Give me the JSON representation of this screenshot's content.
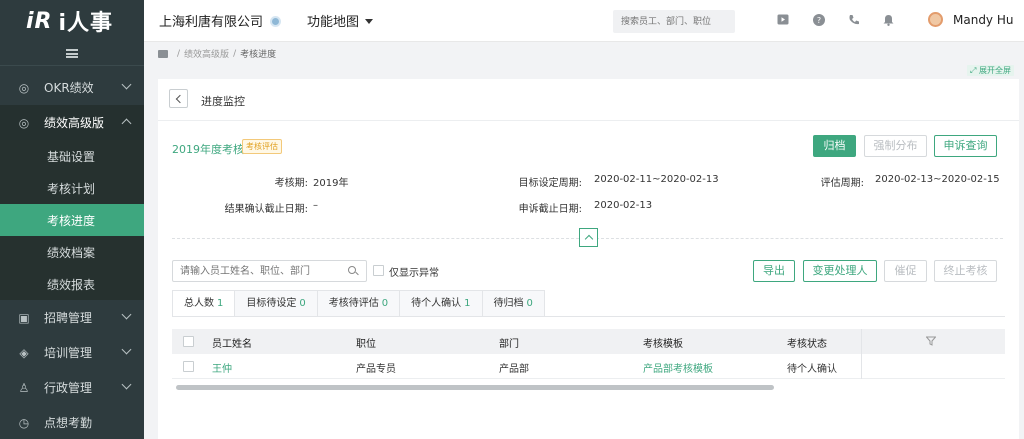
{
  "app": {
    "logo": "i人事",
    "logo_prefix": "iR"
  },
  "sidebar": {
    "items": [
      {
        "label": "OKR绩效",
        "icon": "target-icon"
      },
      {
        "label": "绩效高级版",
        "icon": "target-icon",
        "open": true
      },
      {
        "label": "招聘管理",
        "icon": "recruit-icon"
      },
      {
        "label": "培训管理",
        "icon": "training-icon"
      },
      {
        "label": "行政管理",
        "icon": "admin-icon"
      },
      {
        "label": "点想考勤",
        "icon": "attendance-icon"
      }
    ],
    "sub_items": [
      {
        "label": "基础设置"
      },
      {
        "label": "考核计划"
      },
      {
        "label": "考核进度",
        "active": true
      },
      {
        "label": "绩效档案"
      },
      {
        "label": "绩效报表"
      }
    ]
  },
  "topbar": {
    "company": "上海利唐有限公司",
    "func_map": "功能地图",
    "search_placeholder": "搜索员工、部门、职位",
    "username": "Mandy Hu"
  },
  "breadcrumb": {
    "parent": "绩效高级版",
    "current": "考核进度"
  },
  "fullscreen_label": "展开全屏",
  "panel": {
    "title": "进度监控",
    "review_name": "2019年度考核",
    "review_tag": "考核评估",
    "buttons": {
      "archive": "归档",
      "force_distribute": "强制分布",
      "appeal_query": "申诉查询"
    },
    "info": {
      "period_label": "考核期:",
      "period_value": "2019年",
      "goal_label": "目标设定周期:",
      "goal_value": "2020-02-11~2020-02-13",
      "eval_label": "评估周期:",
      "eval_value": "2020-02-13~2020-02-15",
      "confirm_label": "结果确认截止日期:",
      "confirm_value": "–",
      "appeal_label": "申诉截止日期:",
      "appeal_value": "2020-02-13"
    }
  },
  "filters": {
    "search_placeholder": "请输入员工姓名、职位、部门",
    "only_abnormal": "仅显示异常",
    "export": "导出",
    "change_handler": "变更处理人",
    "remind": "催促",
    "terminate": "终止考核"
  },
  "tabs": [
    {
      "label": "总人数",
      "count": "1",
      "active": true
    },
    {
      "label": "目标待设定",
      "count": "0"
    },
    {
      "label": "考核待评估",
      "count": "0"
    },
    {
      "label": "待个人确认",
      "count": "1"
    },
    {
      "label": "待归档",
      "count": "0"
    }
  ],
  "table": {
    "columns": [
      "员工姓名",
      "职位",
      "部门",
      "考核模板",
      "考核状态"
    ],
    "rows": [
      {
        "name": "王仲",
        "position": "产品专员",
        "department": "产品部",
        "template": "产品部考核模板",
        "status": "待个人确认"
      }
    ]
  },
  "colors": {
    "brand": "#3ea77f",
    "sidebar": "#2e3b3e",
    "tag": "#e0a020"
  }
}
